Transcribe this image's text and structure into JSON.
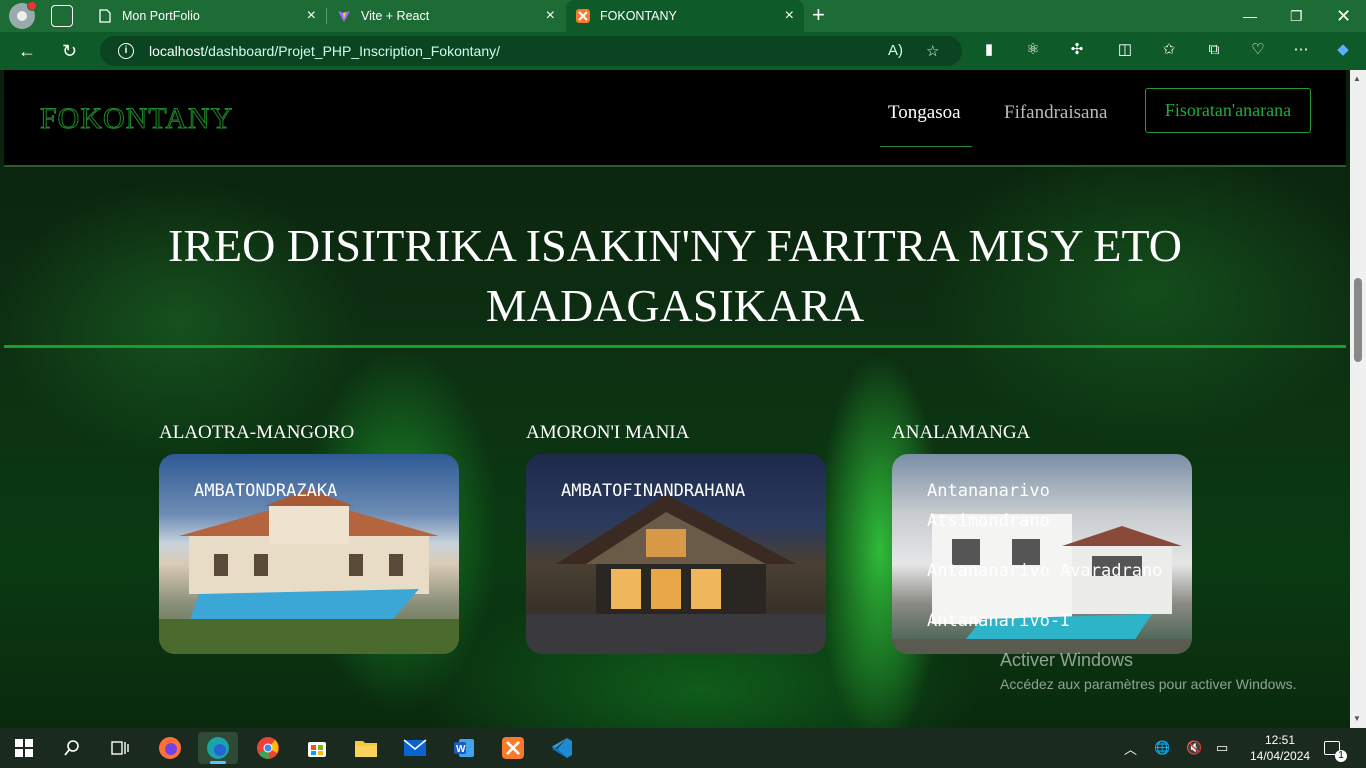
{
  "browser": {
    "tabs": [
      {
        "title": "Mon PortFolio",
        "icon": "page-icon"
      },
      {
        "title": "Vite + React",
        "icon": "vite-icon"
      },
      {
        "title": "FOKONTANY",
        "icon": "xampp-icon",
        "active": true
      }
    ],
    "url_host": "localhost",
    "url_path": "/dashboard/Projet_PHP_Inscription_Fokontany/"
  },
  "site": {
    "logo": "FOKONTANY",
    "nav": [
      {
        "label": "Tongasoa",
        "active": true
      },
      {
        "label": "Fifandraisana",
        "active": false
      }
    ],
    "nav_button": "Fisoratan'anarana",
    "hero_line1": "IREO DISITRIKA ISAKIN'NY FARITRA MISY ETO",
    "hero_line2": "MADAGASIKARA",
    "regions": [
      {
        "name": "ALAOTRA-MANGORO",
        "districts": [
          "AMBATONDRAZAKA"
        ]
      },
      {
        "name": "AMORON'I MANIA",
        "districts": [
          "AMBATOFINANDRAHANA"
        ]
      },
      {
        "name": "ANALAMANGA",
        "districts": [
          "Antananarivo Atsimondrano",
          "Antananarivo Avaradrano",
          "Antananarivo-I"
        ]
      }
    ]
  },
  "watermark": {
    "title": "Activer Windows",
    "subtitle": "Accédez aux paramètres pour activer Windows."
  },
  "taskbar": {
    "time": "12:51",
    "date": "14/04/2024",
    "notifications": "1"
  },
  "colors": {
    "accent": "#1f9a34",
    "chrome": "#0e5a28",
    "tabbar": "#1d6b35"
  }
}
